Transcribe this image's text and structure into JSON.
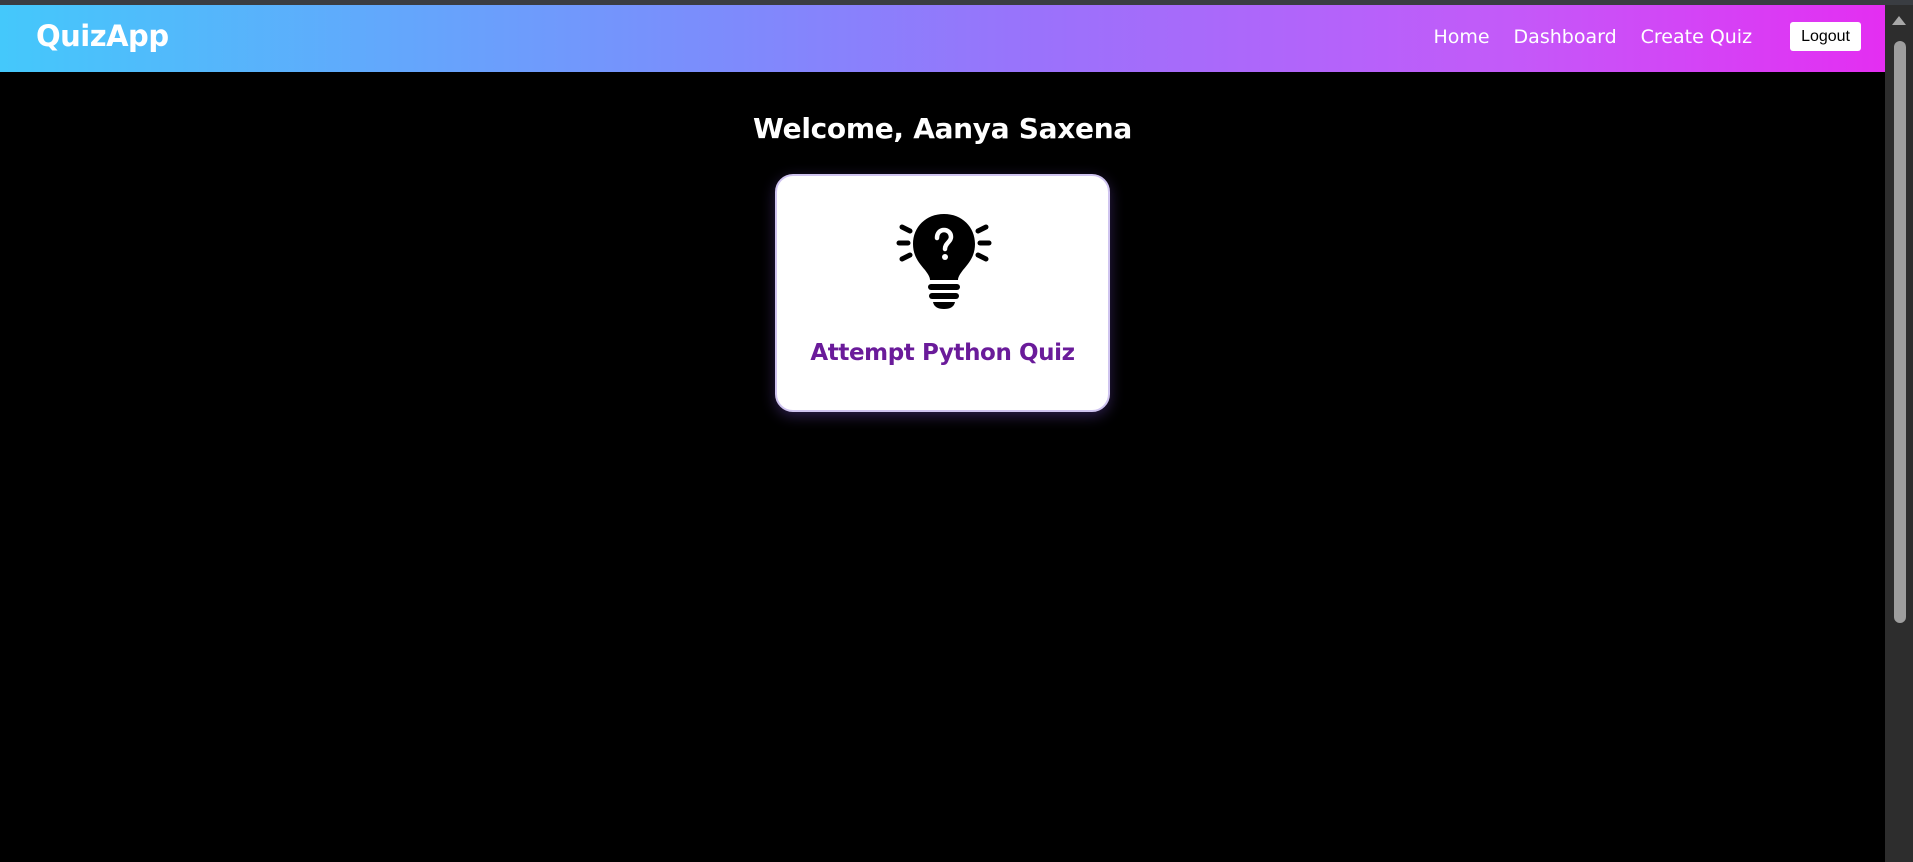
{
  "navbar": {
    "brand": "QuizApp",
    "links": [
      "Home",
      "Dashboard",
      "Create Quiz"
    ],
    "logout_label": "Logout"
  },
  "main": {
    "welcome_text": "Welcome, Aanya Saxena",
    "card": {
      "icon": "lightbulb-question-icon",
      "title": "Attempt Python Quiz"
    }
  },
  "colors": {
    "gradient_start": "#44c8fb",
    "gradient_end": "#e42ef2",
    "background": "#000000",
    "card_title": "#6a1b9a",
    "card_border": "#cfc4ef"
  }
}
